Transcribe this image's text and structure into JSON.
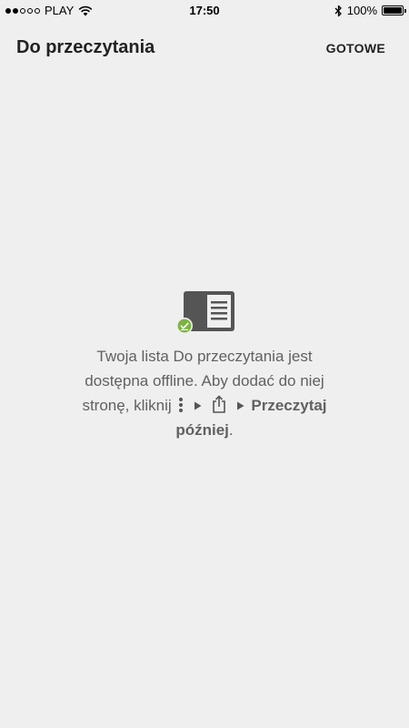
{
  "status_bar": {
    "carrier": "PLAY",
    "time": "17:50",
    "battery": "100%",
    "battery_level": 1.0,
    "signal_bars": 2,
    "signal_total": 5,
    "icons": [
      "wifi-icon",
      "bluetooth-icon",
      "battery-icon"
    ]
  },
  "header": {
    "title": "Do przeczytania",
    "done_label": "GOTOWE"
  },
  "empty_state": {
    "line1": "Twoja lista Do przeczytania jest",
    "line2": "dostępna offline. Aby dodać do niej",
    "line3_text": "stronę, kliknij",
    "line3_bold": "Przeczytaj",
    "line4_bold": "później",
    "line4_end": ".",
    "icons": [
      "reading-list-icon",
      "offline-check-icon",
      "more-vert-icon",
      "arrow-right-icon",
      "share-icon"
    ],
    "colors": {
      "icon_dark": "#555555",
      "check_green": "#7cb342"
    }
  }
}
